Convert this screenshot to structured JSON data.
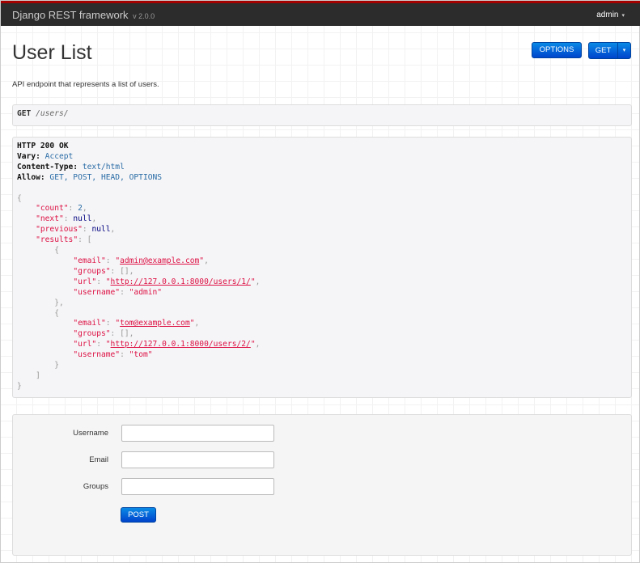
{
  "navbar": {
    "brand": "Django REST framework",
    "version": "v 2.0.0",
    "user": "admin",
    "user_caret": "▾"
  },
  "page": {
    "title": "User List",
    "description": "API endpoint that represents a list of users.",
    "options_label": "OPTIONS",
    "get_label": "GET",
    "get_caret": "▾"
  },
  "request": {
    "method": "GET",
    "path": "/users/"
  },
  "response": {
    "status": "HTTP 200 OK",
    "headers": [
      {
        "key": "Vary:",
        "value": "Accept"
      },
      {
        "key": "Content-Type:",
        "value": "text/html"
      },
      {
        "key": "Allow:",
        "value": "GET, POST, HEAD, OPTIONS"
      }
    ],
    "body_lines": [
      [
        [
          "{",
          "p"
        ]
      ],
      [
        [
          "    ",
          ""
        ],
        [
          "\"count\"",
          "k"
        ],
        [
          ": ",
          "p"
        ],
        [
          "2",
          "n"
        ],
        [
          ",",
          "p"
        ]
      ],
      [
        [
          "    ",
          ""
        ],
        [
          "\"next\"",
          "k"
        ],
        [
          ": ",
          "p"
        ],
        [
          "null",
          "nl"
        ],
        [
          ",",
          "p"
        ]
      ],
      [
        [
          "    ",
          ""
        ],
        [
          "\"previous\"",
          "k"
        ],
        [
          ": ",
          "p"
        ],
        [
          "null",
          "nl"
        ],
        [
          ",",
          "p"
        ]
      ],
      [
        [
          "    ",
          ""
        ],
        [
          "\"results\"",
          "k"
        ],
        [
          ": [",
          "p"
        ]
      ],
      [
        [
          "        {",
          "p"
        ]
      ],
      [
        [
          "            ",
          ""
        ],
        [
          "\"email\"",
          "k"
        ],
        [
          ": ",
          "p"
        ],
        [
          "\"",
          "s"
        ],
        [
          "admin@example.com",
          "a"
        ],
        [
          "\"",
          "s"
        ],
        [
          ",",
          "p"
        ]
      ],
      [
        [
          "            ",
          ""
        ],
        [
          "\"groups\"",
          "k"
        ],
        [
          ": [],",
          "p"
        ]
      ],
      [
        [
          "            ",
          ""
        ],
        [
          "\"url\"",
          "k"
        ],
        [
          ": ",
          "p"
        ],
        [
          "\"",
          "s"
        ],
        [
          "http://127.0.0.1:8000/users/1/",
          "a"
        ],
        [
          "\"",
          "s"
        ],
        [
          ",",
          "p"
        ]
      ],
      [
        [
          "            ",
          ""
        ],
        [
          "\"username\"",
          "k"
        ],
        [
          ": ",
          "p"
        ],
        [
          "\"admin\"",
          "s"
        ]
      ],
      [
        [
          "        },",
          "p"
        ]
      ],
      [
        [
          "        {",
          "p"
        ]
      ],
      [
        [
          "            ",
          ""
        ],
        [
          "\"email\"",
          "k"
        ],
        [
          ": ",
          "p"
        ],
        [
          "\"",
          "s"
        ],
        [
          "tom@example.com",
          "a"
        ],
        [
          "\"",
          "s"
        ],
        [
          ",",
          "p"
        ]
      ],
      [
        [
          "            ",
          ""
        ],
        [
          "\"groups\"",
          "k"
        ],
        [
          ": [],",
          "p"
        ]
      ],
      [
        [
          "            ",
          ""
        ],
        [
          "\"url\"",
          "k"
        ],
        [
          ": ",
          "p"
        ],
        [
          "\"",
          "s"
        ],
        [
          "http://127.0.0.1:8000/users/2/",
          "a"
        ],
        [
          "\"",
          "s"
        ],
        [
          ",",
          "p"
        ]
      ],
      [
        [
          "            ",
          ""
        ],
        [
          "\"username\"",
          "k"
        ],
        [
          ": ",
          "p"
        ],
        [
          "\"tom\"",
          "s"
        ]
      ],
      [
        [
          "        }",
          "p"
        ]
      ],
      [
        [
          "    ]",
          "p"
        ]
      ],
      [
        [
          "}",
          "p"
        ]
      ]
    ]
  },
  "form": {
    "fields": [
      {
        "label": "Username",
        "value": ""
      },
      {
        "label": "Email",
        "value": ""
      },
      {
        "label": "Groups",
        "value": ""
      }
    ],
    "submit_label": "POST"
  }
}
